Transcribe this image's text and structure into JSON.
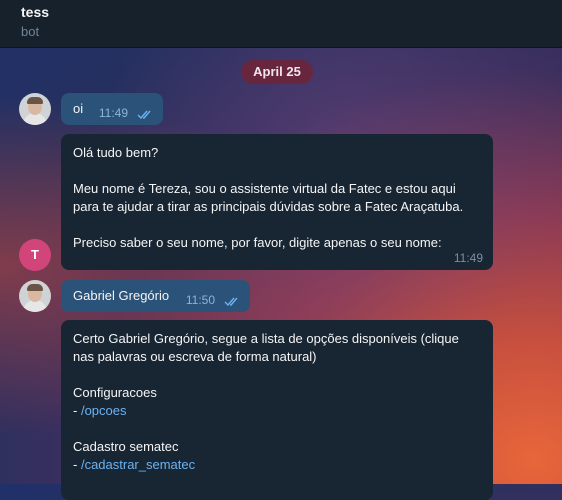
{
  "chat": {
    "title": "tess",
    "subtitle": "bot"
  },
  "date_separator": "April 25",
  "messages": {
    "m1": {
      "text": "oi",
      "time": "11:49"
    },
    "m2": {
      "lines": [
        "Olá tudo bem?",
        "",
        "Meu nome é Tereza, sou o assistente virtual da Fatec e estou aqui",
        "para te ajudar a tirar as principais dúvidas sobre a Fatec Araçatuba.",
        "",
        "Preciso saber o seu nome, por favor, digite apenas o seu nome:"
      ],
      "time": "11:49"
    },
    "m3": {
      "text": "Gabriel Gregório",
      "time": "11:50"
    },
    "m4": {
      "lines": [
        "Certo Gabriel Gregório, segue a lista de opções disponíveis (clique",
        "nas palavras ou escreva de forma natural)",
        "",
        "Configuracoes"
      ],
      "cmd1_prefix": "- ",
      "cmd1": "/opcoes",
      "section2": "Cadastro sematec",
      "cmd2_prefix": "- ",
      "cmd2": "/cadastrar_sematec"
    }
  },
  "bot_avatar_letter": "T",
  "colors": {
    "header_bg": "#17212b",
    "incoming_bubble": "#182533",
    "outgoing_bubble": "#2b5278",
    "link": "#6ab3f3",
    "bot_avatar": "#d2457b"
  }
}
